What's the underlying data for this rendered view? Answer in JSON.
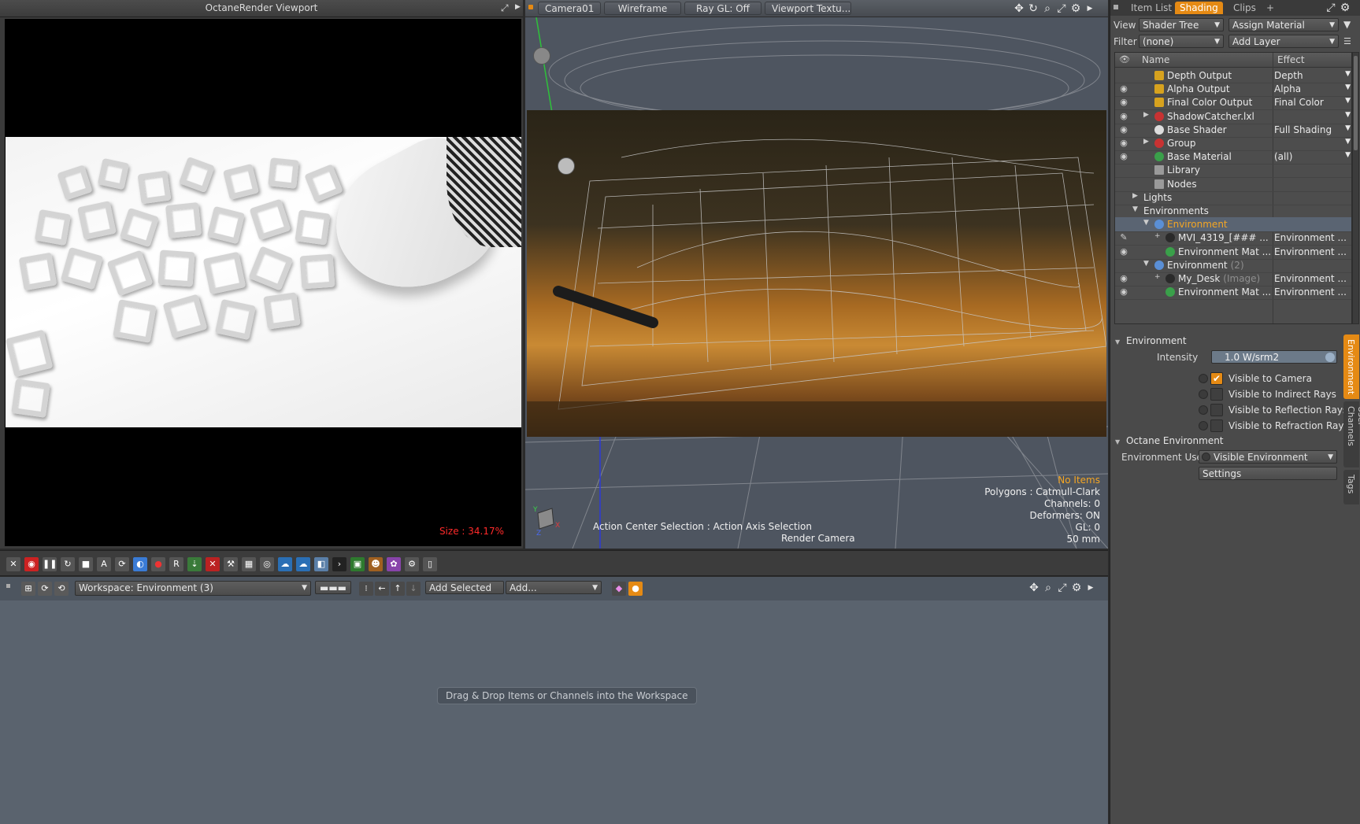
{
  "octane_viewport": {
    "title": "OctaneRender Viewport",
    "size_text": "Size : 34.17%"
  },
  "viewport3d": {
    "toolbar": {
      "camera": "Camera01",
      "shading": "Wireframe",
      "raygl": "Ray GL: Off",
      "texture": "Viewport Textu..."
    },
    "info": {
      "items": "No Items",
      "polygons": "Polygons : Catmull-Clark",
      "channels": "Channels: 0",
      "deformers": "Deformers: ON",
      "gl": "GL: 0",
      "focal": "50 mm"
    },
    "action_center": "Action Center Selection : Action Axis Selection",
    "render_camera": "Render Camera"
  },
  "right_panel": {
    "tabs": [
      "Item List",
      "Shading",
      "Clips",
      "+"
    ],
    "view_label": "View",
    "view_value": "Shader Tree",
    "assign_material": "Assign Material",
    "filter_label": "Filter",
    "filter_value": "(none)",
    "add_layer": "Add Layer",
    "tree_headers": {
      "name": "Name",
      "effect": "Effect"
    },
    "tree_rows": [
      {
        "name": "Depth Output",
        "suffix": "",
        "effect": "Depth",
        "indent": 1
      },
      {
        "name": "Alpha Output",
        "suffix": "",
        "effect": "Alpha",
        "indent": 1
      },
      {
        "name": "Final Color Output",
        "suffix": "",
        "effect": "Final Color",
        "indent": 1
      },
      {
        "name": "ShadowCatcher.lxl",
        "suffix": "",
        "effect": "",
        "indent": 1
      },
      {
        "name": "Base Shader",
        "suffix": "",
        "effect": "Full Shading",
        "indent": 1
      },
      {
        "name": "Group",
        "suffix": "",
        "effect": "",
        "indent": 1
      },
      {
        "name": "Base Material",
        "suffix": "",
        "effect": "(all)",
        "indent": 1
      },
      {
        "name": "Library",
        "suffix": "",
        "effect": "",
        "indent": 1
      },
      {
        "name": "Nodes",
        "suffix": "",
        "effect": "",
        "indent": 1
      },
      {
        "name": "Lights",
        "suffix": "",
        "effect": "",
        "indent": 0
      },
      {
        "name": "Environments",
        "suffix": "",
        "effect": "",
        "indent": 0
      },
      {
        "name": "Environment",
        "suffix": "",
        "effect": "",
        "indent": 1
      },
      {
        "name": "MVI_4319_[### ...",
        "suffix": "",
        "effect": "Environment ...",
        "indent": 2
      },
      {
        "name": "Environment Mat ...",
        "suffix": "",
        "effect": "Environment ...",
        "indent": 2
      },
      {
        "name": "Environment",
        "suffix": "(2)",
        "effect": "",
        "indent": 1
      },
      {
        "name": "My_Desk",
        "suffix": "(Image)",
        "effect": "Environment ...",
        "indent": 2
      },
      {
        "name": "Environment Mat ...",
        "suffix": "",
        "effect": "Environment ...",
        "indent": 2
      }
    ],
    "props": {
      "section_env": "Environment",
      "intensity_label": "Intensity",
      "intensity_value": "1.0 W/srm2",
      "visible_camera": "Visible to Camera",
      "visible_indirect": "Visible to Indirect Rays",
      "visible_reflection": "Visible to Reflection Rays",
      "visible_refraction": "Visible to Refraction Rays",
      "section_octane": "Octane Environment",
      "env_use_label": "Environment Use",
      "env_use_value": "Visible Environment",
      "settings": "Settings"
    },
    "side_tabs": [
      "Environment",
      "User Channels",
      "Tags"
    ]
  },
  "workspace": {
    "workspace_value": "Workspace: Environment (3)",
    "add_selected": "Add Selected",
    "add": "Add...",
    "hint": "Drag & Drop Items or Channels into the Workspace"
  },
  "colors": {
    "accent": "#e58a14",
    "size_text": "#ff2a2a",
    "selected_name": "#f5a623"
  }
}
